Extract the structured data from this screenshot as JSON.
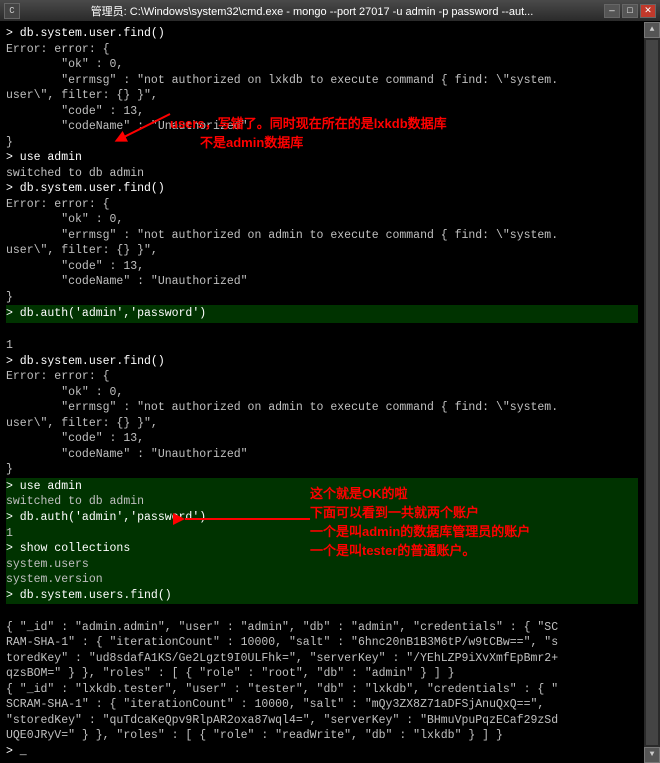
{
  "titlebar": {
    "title": "管理员: C:\\Windows\\system32\\cmd.exe - mongo  --port 27017 -u admin -p password --aut...",
    "minimize_label": "—",
    "maximize_label": "□",
    "close_label": "✕",
    "icon_label": "C"
  },
  "terminal": {
    "content_lines": [
      "> db.system.user.find()",
      "Error: error: {",
      "\t\"ok\" : 0,",
      "\t\"errmsg\" : \"not authorized on lxkdb to execute command { find: \\\"system.",
      "user\\\", filter: {} }\",",
      "\t\"code\" : 13,",
      "\t\"codeName\" : \"Unauthorized\"",
      "}",
      "> use admin",
      "switched to db admin",
      "> db.system.user.find()",
      "Error: error: {",
      "\t\"ok\" : 0,",
      "\t\"errmsg\" : \"not authorized on admin to execute command { find: \\\"system.",
      "user\\\", filter: {} }\",",
      "\t\"code\" : 13,",
      "\t\"codeName\" : \"Unauthorized\"",
      "}",
      "> db.auth('admin','password')",
      "1",
      "> db.system.user.find()",
      "Error: error: {",
      "\t\"ok\" : 0,",
      "\t\"errmsg\" : \"not authorized on admin to execute command { find: \\\"system.",
      "user\\\", filter: {} }\",",
      "\t\"code\" : 13,",
      "\t\"codeName\" : \"Unauthorized\"",
      "}",
      "> use admin",
      "switched to db admin",
      "> db.auth('admin','password')",
      "1",
      "> show collections",
      "system.users",
      "system.version",
      "> db.system.users.find()",
      "{ \"_id\" : \"admin.admin\", \"user\" : \"admin\", \"db\" : \"admin\", \"credentials\" : { \"SC",
      "RAM-SHA-1\" : { \"iterationCount\" : 10000, \"salt\" : \"6hnc20nB1B3M6tP/w9tCBw==\", \"s",
      "toredKey\" : \"ud8sdafA1KS/Ge2Lgzt9I0ULFhk=\", \"serverKey\" : \"/YEhLZP9iXvXmfEpBmr2+",
      "qzsBOM=\" } }, \"roles\" : [ { \"role\" : \"root\", \"db\" : \"admin\" } ] }",
      "{ \"_id\" : \"lxkdb.tester\", \"user\" : \"tester\", \"db\" : \"lxkdb\", \"credentials\" : { \"",
      "SCRAM-SHA-1\" : { \"iterationCount\" : 10000, \"salt\" : \"mQy3ZX8Z71aDFSjAnuQxQ==\",",
      "\"storedKey\" : \"quTdcaKeQpv9RlpAR2oxa87wql4=\", \"serverKey\" : \"BHmuVpuPqzECaf29zSd",
      "UQE0JRyV=\" } }, \"roles\" : [ { \"role\" : \"readWrite\", \"db\" : \"lxkdb\" } ] }",
      "> _"
    ]
  },
  "annotations": {
    "annotation1": {
      "text": "users，写错了。同时现在所在的是lxkdb数据库",
      "subtext": "不是admin数据库"
    },
    "annotation2": {
      "text": "这个就是OK的啦",
      "subtext1": "下面可以看到一共就两个账户",
      "subtext2": "一个是叫admin的数据库管理员的账户",
      "subtext3": "一个是叫tester的普通账户。"
    }
  }
}
